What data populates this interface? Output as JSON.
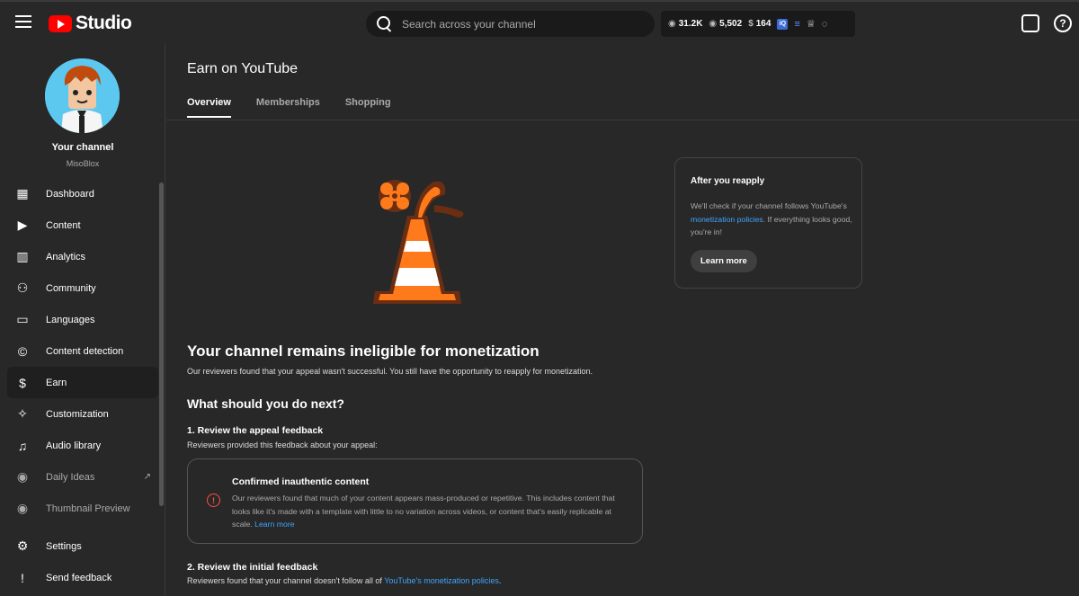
{
  "app": {
    "logo_text": "Studio",
    "accent": "#ff0000",
    "link_color": "#3ea6ff"
  },
  "search": {
    "placeholder": "Search across your channel"
  },
  "stats": {
    "views": "31.2K",
    "subs": "5,502",
    "revenue": "164"
  },
  "channel": {
    "title": "Your channel",
    "name": "MisoBlox"
  },
  "sidebar": {
    "items": [
      {
        "label": "Dashboard",
        "icon": "dashboard-icon"
      },
      {
        "label": "Content",
        "icon": "content-icon"
      },
      {
        "label": "Analytics",
        "icon": "analytics-icon"
      },
      {
        "label": "Community",
        "icon": "community-icon"
      },
      {
        "label": "Languages",
        "icon": "languages-icon"
      },
      {
        "label": "Content detection",
        "icon": "copyright-icon"
      },
      {
        "label": "Earn",
        "icon": "dollar-icon"
      },
      {
        "label": "Customization",
        "icon": "magic-wand-icon"
      },
      {
        "label": "Audio library",
        "icon": "audio-library-icon"
      },
      {
        "label": "Daily Ideas",
        "icon": "extension-icon"
      },
      {
        "label": "Thumbnail Preview",
        "icon": "extension-icon"
      }
    ],
    "bottom": [
      {
        "label": "Settings",
        "icon": "gear-icon"
      },
      {
        "label": "Send feedback",
        "icon": "feedback-icon"
      }
    ]
  },
  "main": {
    "title": "Earn on YouTube",
    "tabs": [
      "Overview",
      "Memberships",
      "Shopping"
    ],
    "headline": "Your channel remains ineligible for monetization",
    "headline_sub": "Our reviewers found that your appeal wasn't successful. You still have the opportunity to reapply for monetization.",
    "what_next": "What should you do next?",
    "step1_title": "1. Review the appeal feedback",
    "step1_sub": "Reviewers provided this feedback about your appeal:",
    "feedback": {
      "title": "Confirmed inauthentic content",
      "text": "Our reviewers found that much of your content appears mass-produced or repetitive. This includes content that looks like it's made with a template with little to no variation across videos, or content that's easily replicable at scale.",
      "link": "Learn more"
    },
    "step2_title": "2. Review the initial feedback",
    "step2_sub": "Reviewers found that your channel doesn't follow all of",
    "step2_link": "YouTube's monetization policies",
    "step2_end": "."
  },
  "reapply": {
    "title": "After you reapply",
    "text_before": "We'll check if your channel follows YouTube's",
    "link": "monetization policies",
    "text_after": ". If everything looks good, you're in!",
    "button": "Learn more"
  }
}
